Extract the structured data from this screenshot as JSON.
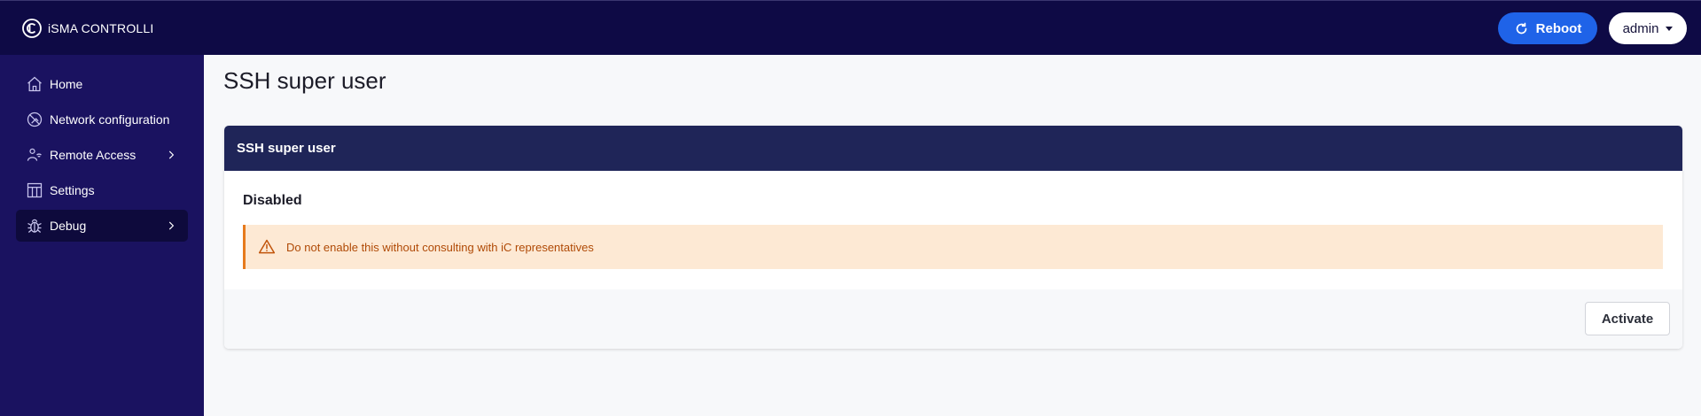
{
  "brand": {
    "name": "iSMA CONTROLLI",
    "logo_icon": "ismac-logo-icon"
  },
  "header": {
    "reboot_label": "Reboot",
    "reboot_icon": "refresh-icon",
    "user_label": "admin",
    "colors": {
      "topbar": "#0e0a45",
      "reboot": "#1f63e8"
    }
  },
  "sidebar": {
    "items": [
      {
        "label": "Home",
        "icon": "home-icon",
        "has_submenu": false,
        "active": false
      },
      {
        "label": "Network configuration",
        "icon": "network-icon",
        "has_submenu": false,
        "active": false
      },
      {
        "label": "Remote Access",
        "icon": "remote-access-icon",
        "has_submenu": true,
        "active": false
      },
      {
        "label": "Settings",
        "icon": "settings-icon",
        "has_submenu": false,
        "active": false
      },
      {
        "label": "Debug",
        "icon": "bug-icon",
        "has_submenu": true,
        "active": true
      }
    ],
    "colors": {
      "background": "#1a1260",
      "active": "#0e0a3c"
    }
  },
  "main": {
    "page_title": "SSH super user",
    "card": {
      "title": "SSH super user",
      "status": "Disabled",
      "warning": "Do not enable this without consulting with iC representatives",
      "warning_icon": "warning-icon",
      "activate_label": "Activate",
      "colors": {
        "header": "#1f2558",
        "warning_bg": "#fde9d4",
        "warning_text": "#b04a06"
      }
    }
  }
}
